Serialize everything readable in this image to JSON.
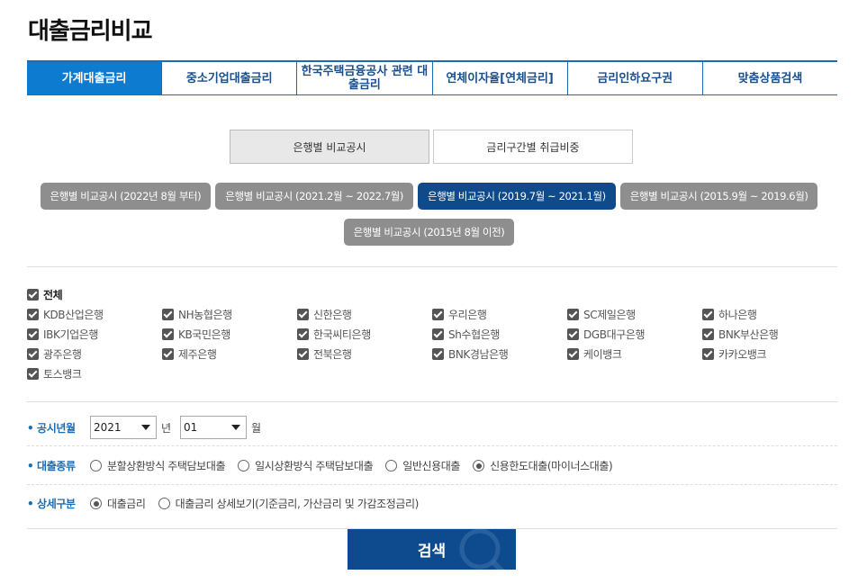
{
  "page": {
    "title": "대출금리비교"
  },
  "main_tabs": [
    {
      "label": "가계대출금리",
      "active": true
    },
    {
      "label": "중소기업대출금리",
      "active": false
    },
    {
      "label": "한국주택금융공사 관련 대출금리",
      "active": false
    },
    {
      "label": "연체이자율[연체금리]",
      "active": false
    },
    {
      "label": "금리인하요구권",
      "active": false
    },
    {
      "label": "맞춤상품검색",
      "active": false
    }
  ],
  "sub_tabs": [
    {
      "label": "은행별 비교공시",
      "active": true
    },
    {
      "label": "금리구간별 취급비중",
      "active": false
    }
  ],
  "periods": [
    {
      "label": "은행별 비교공시 (2022년 8월 부터)",
      "active": false
    },
    {
      "label": "은행별 비교공시 (2021.2월 ~ 2022.7월)",
      "active": false
    },
    {
      "label": "은행별 비교공시 (2019.7월 ~ 2021.1월)",
      "active": true
    },
    {
      "label": "은행별 비교공시 (2015.9월 ~ 2019.6월)",
      "active": false
    },
    {
      "label": "은행별 비교공시 (2015년 8월 이전)",
      "active": false
    }
  ],
  "banks": {
    "all_label": "전체",
    "items": [
      "KDB산업은행",
      "NH농협은행",
      "신한은행",
      "우리은행",
      "SC제일은행",
      "하나은행",
      "IBK기업은행",
      "KB국민은행",
      "한국씨티은행",
      "Sh수협은행",
      "DGB대구은행",
      "BNK부산은행",
      "광주은행",
      "제주은행",
      "전북은행",
      "BNK경남은행",
      "케이뱅크",
      "카카오뱅크",
      "토스뱅크"
    ]
  },
  "filters": {
    "period_label": "• 공시년월",
    "year_value": "2021",
    "year_unit": "년",
    "month_value": "01",
    "month_unit": "월",
    "loan_type_label": "• 대출종류",
    "loan_types": [
      {
        "label": "분할상환방식 주택담보대출",
        "selected": false
      },
      {
        "label": "일시상환방식 주택담보대출",
        "selected": false
      },
      {
        "label": "일반신용대출",
        "selected": false
      },
      {
        "label": "신용한도대출(마이너스대출)",
        "selected": true
      }
    ],
    "detail_label": "• 상세구분",
    "details": [
      {
        "label": "대출금리",
        "selected": true
      },
      {
        "label": "대출금리 상세보기(기준금리, 가산금리 및 가감조정금리)",
        "selected": false
      }
    ]
  },
  "search": {
    "label": "검색",
    "icon": "magnifier-icon"
  },
  "colors": {
    "accent": "#0c7bd0",
    "navy": "#0d4a8e",
    "pill_gray": "#8e8e8e"
  }
}
